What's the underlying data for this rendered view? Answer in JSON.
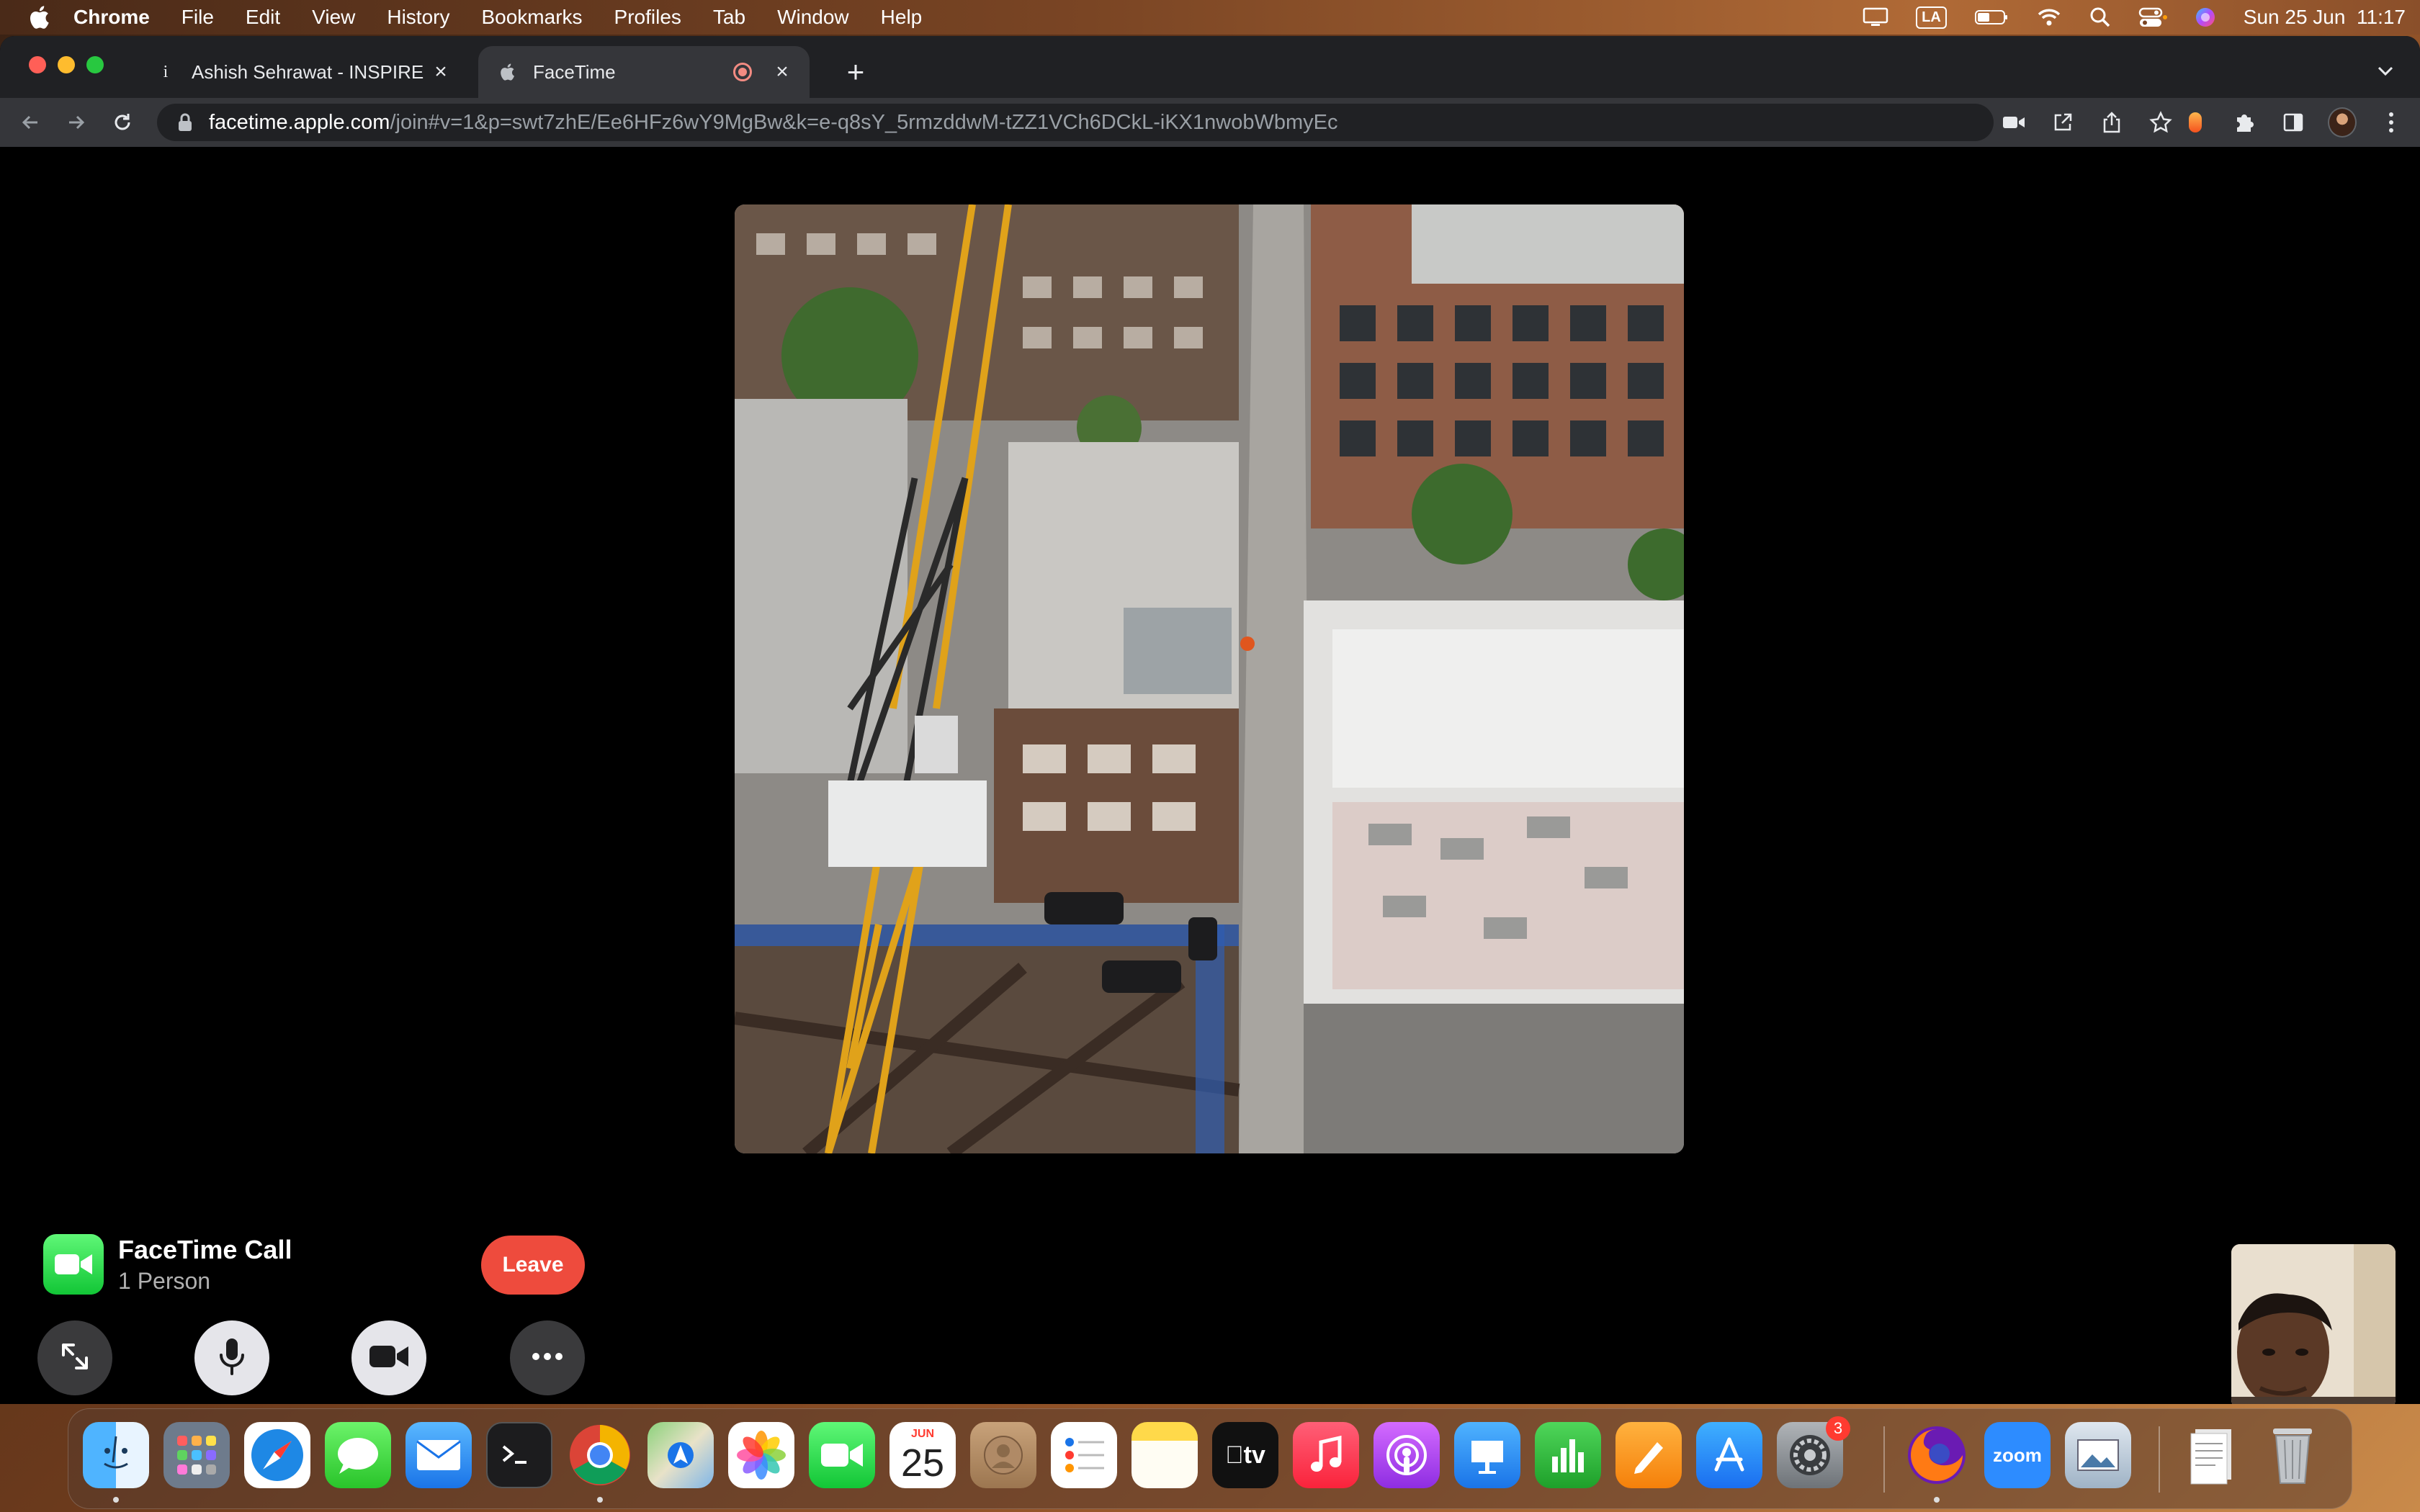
{
  "menubar": {
    "app_name": "Chrome",
    "menus": [
      "File",
      "Edit",
      "View",
      "History",
      "Bookmarks",
      "Profiles",
      "Tab",
      "Window",
      "Help"
    ],
    "language": "LA",
    "datetime": "Sun 25 Jun  11:17"
  },
  "browser": {
    "tabs": [
      {
        "title": "Ashish Sehrawat - INSPIRE",
        "favicon": "i",
        "active": false
      },
      {
        "title": "FaceTime",
        "active": true,
        "recording": true
      }
    ],
    "url": {
      "host": "facetime.apple.com",
      "path": "/join#v=1&p=swt7zhE/Ee6HFz6wY9MgBw&k=e-q8sY_5rmzddwM-tZZ1VCh6DCkL-iKX1nwobWbmyEc"
    }
  },
  "facetime": {
    "call_title": "FaceTime Call",
    "participants": "1 Person",
    "leave_label": "Leave",
    "controls": [
      "fullscreen-icon",
      "microphone-icon",
      "video-camera-icon",
      "more-icon"
    ]
  },
  "dock": {
    "apps": [
      "Finder",
      "Launchpad",
      "Safari",
      "Messages",
      "Mail",
      "Terminal",
      "Google Chrome",
      "Maps",
      "Photos",
      "FaceTime",
      "Calendar",
      "Contacts",
      "Reminders",
      "Notes",
      "Apple TV",
      "Music",
      "Podcasts",
      "Keynote",
      "Numbers",
      "Pages",
      "App Store",
      "System Settings",
      "Firefox",
      "Zoom",
      "Preview",
      "Documents",
      "Trash"
    ],
    "calendar": {
      "month": "JUN",
      "day": "25"
    },
    "tv_label": "tv",
    "zoom_label": "zoom",
    "settings_badge": "3"
  }
}
